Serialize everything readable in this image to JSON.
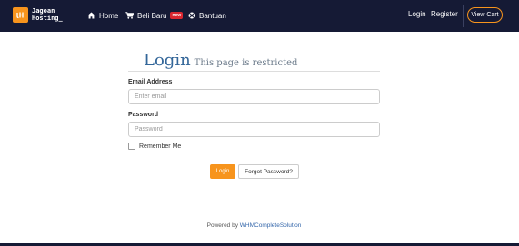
{
  "brand": {
    "name_line1": "Jagoan",
    "name_line2": "Hosting_",
    "logo_icon": "jh-logo-icon",
    "accent_color": "#f7941d",
    "navbar_color": "#151a35"
  },
  "nav": {
    "home": {
      "label": "Home",
      "icon": "home-icon"
    },
    "beli_baru": {
      "label": "Beli Baru",
      "icon": "cart-icon",
      "badge": "new"
    },
    "bantuan": {
      "label": "Bantuan",
      "icon": "lifebuoy-icon"
    },
    "login": "Login",
    "register": "Register",
    "view_cart": "View Cart"
  },
  "page": {
    "title": "Login",
    "subtitle": "This page is restricted"
  },
  "form": {
    "email_label": "Email Address",
    "email_placeholder": "Enter email",
    "email_value": "",
    "password_label": "Password",
    "password_placeholder": "Password",
    "password_value": "",
    "remember_label": "Remember Me",
    "remember_checked": false,
    "login_button": "Login",
    "forgot_button": "Forgot Password?"
  },
  "footer": {
    "powered_prefix": "Powered by ",
    "powered_link": "WHMCompleteSolution"
  }
}
